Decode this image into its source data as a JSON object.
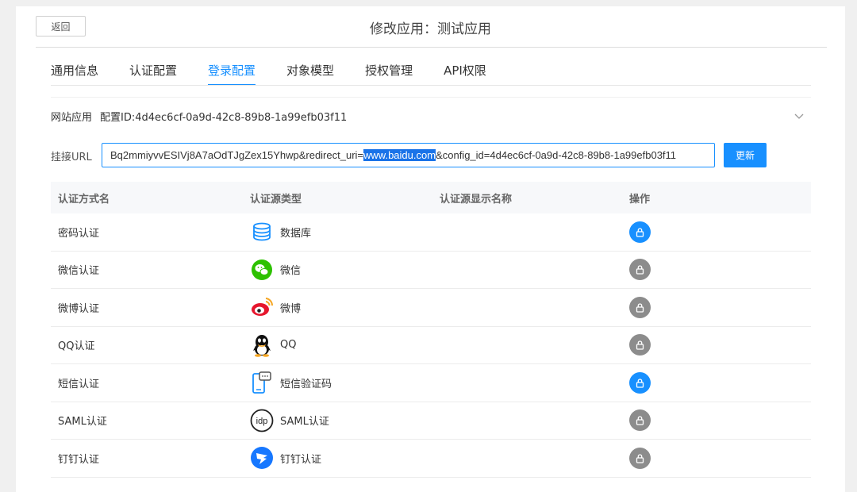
{
  "header": {
    "back_label": "返回",
    "title": "修改应用：测试应用"
  },
  "tabs": [
    {
      "label": "通用信息",
      "active": false
    },
    {
      "label": "认证配置",
      "active": false
    },
    {
      "label": "登录配置",
      "active": true
    },
    {
      "label": "对象模型",
      "active": false
    },
    {
      "label": "授权管理",
      "active": false
    },
    {
      "label": "API权限",
      "active": false
    }
  ],
  "app_info": {
    "type_label": "网站应用",
    "config_id": "配置ID:4d4ec6cf-0a9d-42c8-89b8-1a99efb03f11"
  },
  "url": {
    "label": "挂接URL",
    "before": "Bq2mmiyvvESIVj8A7aOdTJgZex15Yhwp&redirect_uri=",
    "selected": "www.baidu.com",
    "after": "&config_id=4d4ec6cf-0a9d-42c8-89b8-1a99efb03f11",
    "update_label": "更新"
  },
  "table": {
    "headers": [
      "认证方式名",
      "认证源类型",
      "认证源显示名称",
      "操作"
    ],
    "rows": [
      {
        "name": "密码认证",
        "source": "数据库",
        "icon": "database-icon",
        "enabled": true
      },
      {
        "name": "微信认证",
        "source": "微信",
        "icon": "wechat-icon",
        "enabled": false
      },
      {
        "name": "微博认证",
        "source": "微博",
        "icon": "weibo-icon",
        "enabled": false
      },
      {
        "name": "QQ认证",
        "source": "QQ",
        "icon": "qq-icon",
        "enabled": false
      },
      {
        "name": "短信认证",
        "source": "短信验证码",
        "icon": "sms-icon",
        "enabled": true
      },
      {
        "name": "SAML认证",
        "source": "SAML认证",
        "icon": "idp-icon",
        "enabled": false
      },
      {
        "name": "钉钉认证",
        "source": "钉钉认证",
        "icon": "dingtalk-icon",
        "enabled": false
      }
    ]
  },
  "colors": {
    "accent": "#1890ff",
    "disabled": "#8c8c8c",
    "wechat": "#2dc100",
    "weibo": "#e6162d",
    "dingtalk": "#1677ff"
  }
}
